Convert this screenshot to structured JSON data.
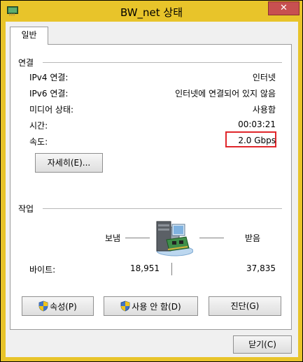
{
  "window": {
    "title": "BW_net 상태",
    "close_symbol": "✕",
    "app_icon": "network-adapter-icon",
    "titlebar_color": "#e8c42a",
    "close_color": "#c75050"
  },
  "tabs": [
    {
      "label": "일반"
    }
  ],
  "connection": {
    "header": "연결",
    "rows": [
      {
        "label": "IPv4 연결:",
        "value": "인터넷"
      },
      {
        "label": "IPv6 연결:",
        "value": "인터넷에 연결되어 있지 않음"
      },
      {
        "label": "미디어 상태:",
        "value": "사용함"
      },
      {
        "label": "시간:",
        "value": "00:03:21"
      },
      {
        "label": "속도:",
        "value": "2.0 Gbps"
      }
    ],
    "details_button": "자세히(E)...",
    "highlight_color": "#e0262b"
  },
  "activity": {
    "header": "작업",
    "sent_label": "보냄",
    "received_label": "받음",
    "bytes_label": "바이트:",
    "bytes_sent": "18,951",
    "bytes_received": "37,835",
    "icon": "network-computer-icon"
  },
  "action_buttons": [
    {
      "label": "속성(P)",
      "icon": "uac-shield-icon"
    },
    {
      "label": "사용 안 함(D)",
      "icon": "uac-shield-icon"
    },
    {
      "label": "진단(G)",
      "icon": ""
    }
  ],
  "footer": {
    "close_button": "닫기(C)"
  }
}
